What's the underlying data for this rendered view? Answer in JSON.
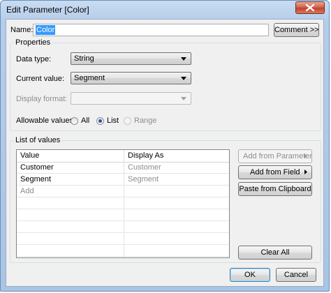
{
  "window": {
    "title": "Edit Parameter [Color]"
  },
  "name_row": {
    "label": "Name:",
    "value": "Color",
    "comment_button": "Comment >>"
  },
  "properties": {
    "title": "Properties",
    "data_type_label": "Data type:",
    "data_type_value": "String",
    "current_value_label": "Current value:",
    "current_value_value": "Segment",
    "display_format_label": "Display format:",
    "display_format_value": "",
    "allowable_values_label": "Allowable values:",
    "options": [
      {
        "label": "All",
        "selected": false,
        "enabled": true
      },
      {
        "label": "List",
        "selected": true,
        "enabled": true
      },
      {
        "label": "Range",
        "selected": false,
        "enabled": false
      }
    ]
  },
  "list_of_values": {
    "title": "List of values",
    "columns": [
      "Value",
      "Display As"
    ],
    "rows": [
      {
        "value": "Customer",
        "display": "Customer"
      },
      {
        "value": "Segment",
        "display": "Segment"
      }
    ],
    "add_placeholder": "Add",
    "buttons": {
      "add_from_parameter": "Add from Parameter",
      "add_from_field": "Add from Field",
      "paste_from_clipboard": "Paste from Clipboard",
      "clear_all": "Clear All"
    }
  },
  "footer": {
    "ok": "OK",
    "cancel": "Cancel"
  }
}
